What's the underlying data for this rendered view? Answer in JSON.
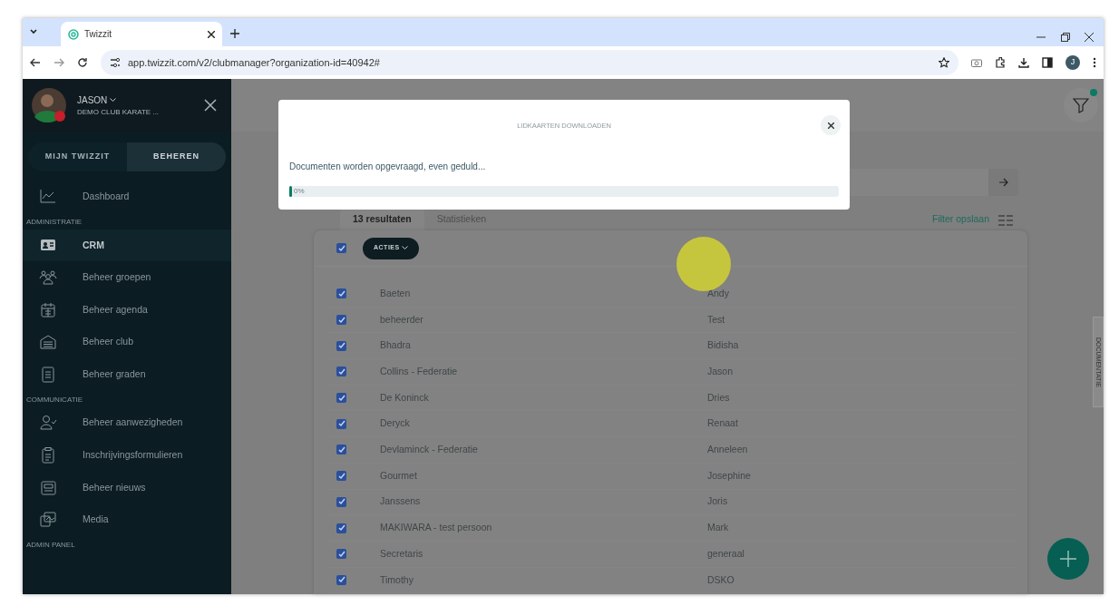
{
  "browser": {
    "tab_title": "Twizzit",
    "url": "app.twizzit.com/v2/clubmanager?organization-id=40942#",
    "avatar_letter": "J"
  },
  "sidebar": {
    "user_name": "JASON",
    "club": "DEMO CLUB KARATE ...",
    "toggle": [
      {
        "label": "MIJN TWIZZIT",
        "selected": false
      },
      {
        "label": "BEHEREN",
        "selected": true
      }
    ],
    "sections": [
      {
        "items": [
          {
            "label": "Dashboard",
            "selected": false
          }
        ]
      },
      {
        "heading": "ADMINISTRATIE",
        "items": [
          {
            "label": "CRM",
            "selected": true
          },
          {
            "label": "Beheer groepen",
            "selected": false
          },
          {
            "label": "Beheer agenda",
            "selected": false
          },
          {
            "label": "Beheer club",
            "selected": false
          },
          {
            "label": "Beheer graden",
            "selected": false
          }
        ]
      },
      {
        "heading": "COMMUNICATIE",
        "items": [
          {
            "label": "Beheer aanwezigheden",
            "selected": false
          },
          {
            "label": "Inschrijvingsformulieren",
            "selected": false
          },
          {
            "label": "Beheer nieuws",
            "selected": false
          },
          {
            "label": "Media",
            "selected": false
          }
        ]
      },
      {
        "heading": "ADMIN PANEL"
      }
    ]
  },
  "main": {
    "filter_active": true,
    "tabs": [
      {
        "label": "13 resultaten",
        "selected": true
      },
      {
        "label": "Statistieken",
        "selected": false
      }
    ],
    "filter_link": "Filter opslaan",
    "select_all_checked": true,
    "actions_button": "ACTIES",
    "rows": [
      {
        "last_name": "Baeten",
        "first_name": "Andy",
        "checked": true
      },
      {
        "last_name": "beheerder",
        "first_name": "Test",
        "checked": true
      },
      {
        "last_name": "Bhadra",
        "first_name": "Bidisha",
        "checked": true
      },
      {
        "last_name": "Collins - Federatie",
        "first_name": "Jason",
        "checked": true
      },
      {
        "last_name": "De Koninck",
        "first_name": "Dries",
        "checked": true
      },
      {
        "last_name": "Deryck",
        "first_name": "Renaat",
        "checked": true
      },
      {
        "last_name": "Devlaminck - Federatie",
        "first_name": "Anneleen",
        "checked": true
      },
      {
        "last_name": "Gourmet",
        "first_name": "Josephine",
        "checked": true
      },
      {
        "last_name": "Janssens",
        "first_name": "Joris",
        "checked": true
      },
      {
        "last_name": "MAKIWARA - test persoon",
        "first_name": "Mark",
        "checked": true
      },
      {
        "last_name": "Secretaris",
        "first_name": "generaal",
        "checked": true
      },
      {
        "last_name": "Timothy",
        "first_name": "DSKO",
        "checked": true
      }
    ],
    "side_tab": "DOCUMENTATIE"
  },
  "modal": {
    "title": "LIDKAARTEN DOWNLOADEN",
    "message": "Documenten worden opgevraagd, even geduld...",
    "progress": {
      "level": 0,
      "reading": "0%"
    }
  }
}
